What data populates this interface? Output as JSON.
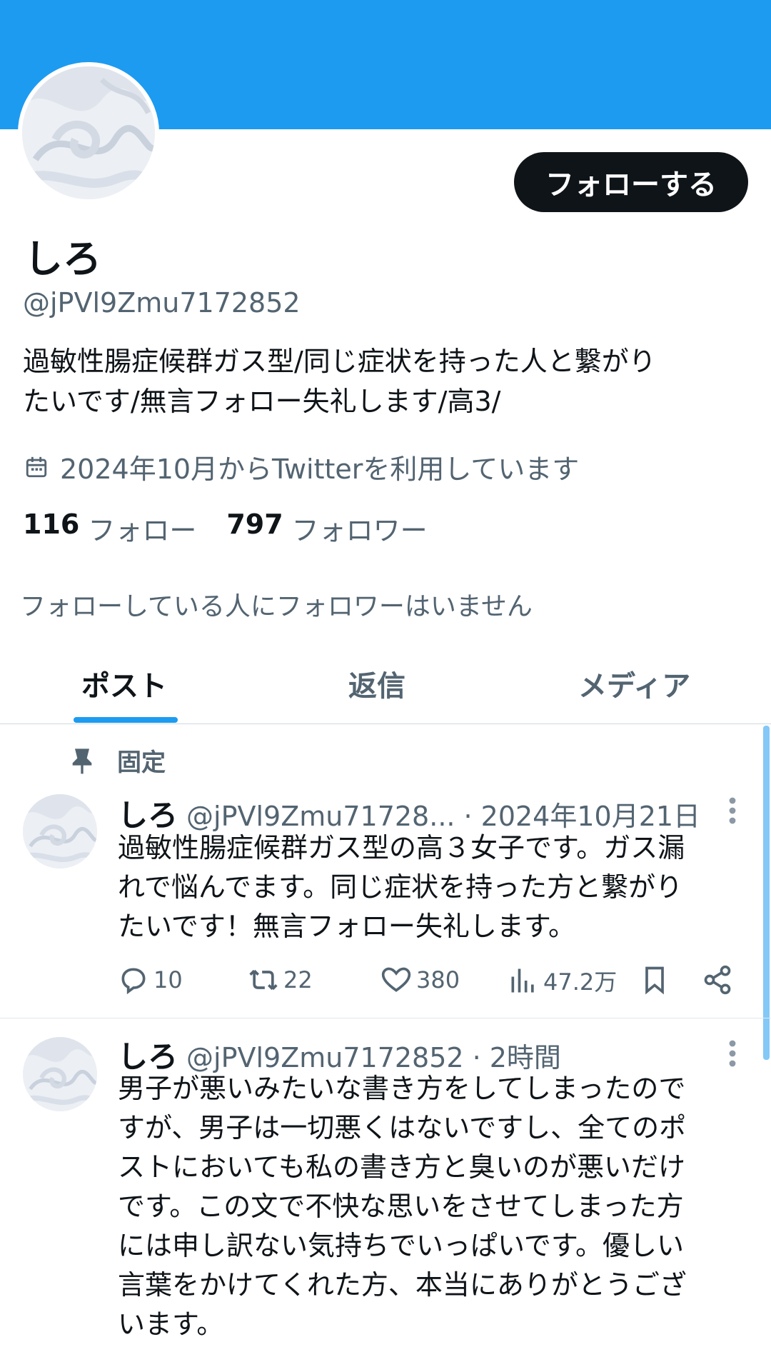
{
  "profile": {
    "display_name": "しろ",
    "handle": "@jPVl9Zmu7172852",
    "bio_line1": "過敏性腸症候群ガス型/同じ症状を持った人と繋がり",
    "bio_line2": "たいです/無言フォロー失礼します/高3/",
    "joined": "2024年10月からTwitterを利用しています",
    "following_count": "116",
    "following_label": "フォロー",
    "followers_count": "797",
    "followers_label": "フォロワー",
    "no_common_followers": "フォローしている人にフォロワーはいません",
    "follow_button": "フォローする"
  },
  "tabs": [
    {
      "label": "ポスト",
      "active": true
    },
    {
      "label": "返信",
      "active": false
    },
    {
      "label": "メディア",
      "active": false
    }
  ],
  "posts": [
    {
      "pinned_label": "固定",
      "name": "しろ",
      "handle": "@jPVl9Zmu71728...",
      "time": "· 2024年10月21日",
      "lines": [
        "過敏性腸症候群ガス型の高３女子です。ガス漏",
        "れで悩んでます。同じ症状を持った方と繋がり",
        "たいです！無言フォロー失礼します。"
      ],
      "replies": "10",
      "reposts": "22",
      "likes": "380",
      "views": "47.2万"
    },
    {
      "name": "しろ",
      "handle": "@jPVl9Zmu7172852",
      "time": "· 2時間",
      "lines": [
        "男子が悪いみたいな書き方をしてしまったので",
        "すが、男子は一切悪くはないですし、全てのポ",
        "ストにおいても私の書き方と臭いのが悪いだけ",
        "です。この文で不快な思いをさせてしまった方",
        "には申し訳ない気持ちでいっぱいです。優しい",
        "言葉をかけてくれた方、本当にありがとうござ",
        "います。"
      ]
    }
  ],
  "colors": {
    "accent": "#1d9bf0",
    "text_primary": "#0f1419",
    "text_secondary": "#536471"
  }
}
